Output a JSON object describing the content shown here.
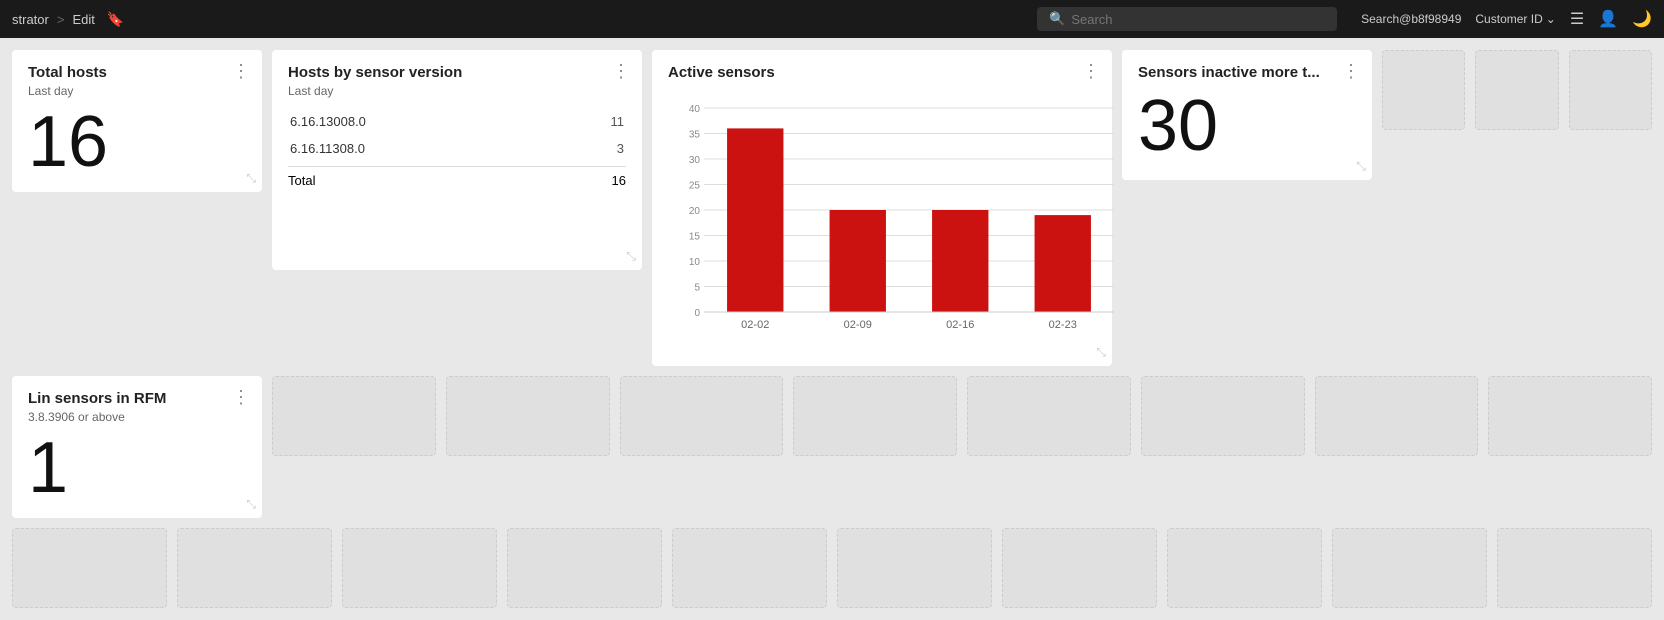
{
  "nav": {
    "brand": "strator",
    "separator": ">",
    "edit_label": "Edit",
    "search_placeholder": "Search",
    "user_email": "Search@b8f98949",
    "customer_label": "Customer ID",
    "customer_chevron": "⌄"
  },
  "cards": {
    "total_hosts": {
      "title": "Total hosts",
      "subtitle": "Last day",
      "value": "16"
    },
    "lin_sensors": {
      "title": "Lin sensors in RFM",
      "subtitle": "3.8.3906 or above",
      "value": "1"
    },
    "sensor_version": {
      "title": "Hosts by sensor version",
      "subtitle": "Last day",
      "versions": [
        {
          "version": "6.16.13008.0",
          "count": "11"
        },
        {
          "version": "6.16.11308.0",
          "count": "3"
        }
      ],
      "total_label": "Total",
      "total_value": "16"
    },
    "active_sensors": {
      "title": "Active sensors",
      "y_labels": [
        "40",
        "35",
        "30",
        "25",
        "20",
        "15",
        "10",
        "5",
        "0"
      ],
      "bars": [
        {
          "label": "02-02",
          "value": 36
        },
        {
          "label": "02-09",
          "value": 20
        },
        {
          "label": "02-16",
          "value": 20
        },
        {
          "label": "02-23",
          "value": 19
        }
      ],
      "max_value": 40
    },
    "sensors_inactive": {
      "title": "Sensors inactive more t...",
      "value": "30"
    }
  },
  "icons": {
    "search": "🔍",
    "menu_dots": "⋮",
    "bookmark": "🔖",
    "resize": "⤡",
    "user": "👤",
    "moon": "🌙",
    "lines": "☰"
  }
}
